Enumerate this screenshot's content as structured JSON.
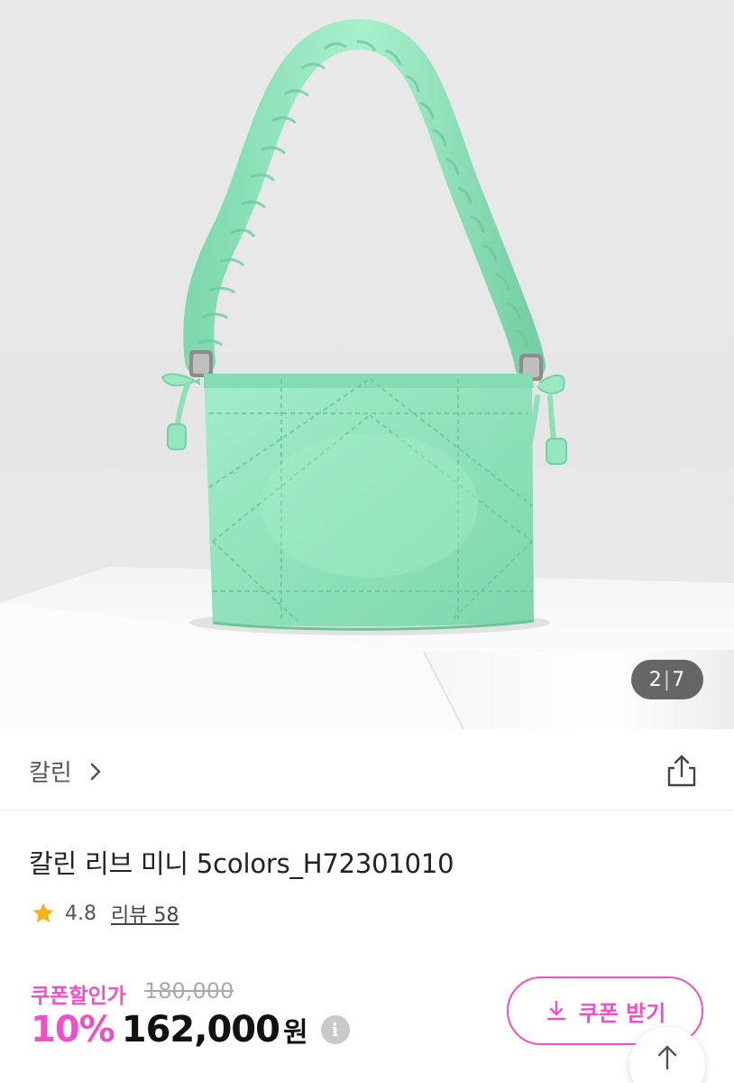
{
  "gallery": {
    "current": "2",
    "total": "7",
    "separator": "|"
  },
  "brand": {
    "name": "칼린"
  },
  "product": {
    "title": "칼린 리브 미니 5colors_H72301010",
    "rating": "4.8",
    "review_label": "리뷰 58"
  },
  "price": {
    "coupon_label": "쿠폰할인가",
    "original": "180,000",
    "discount": "10%",
    "final": "162,000",
    "currency": "원",
    "info_glyph": "i"
  },
  "coupon_button": {
    "label": "쿠폰 받기"
  },
  "colors": {
    "accent": "#f04fc9",
    "star": "#f6b319",
    "product_mint": "#93e6bd"
  },
  "icons": {
    "brand_chevron": "chevron-right-icon",
    "share": "share-icon",
    "star": "star-icon",
    "info": "info-icon",
    "download": "download-icon",
    "scroll_top": "arrow-up-icon"
  }
}
